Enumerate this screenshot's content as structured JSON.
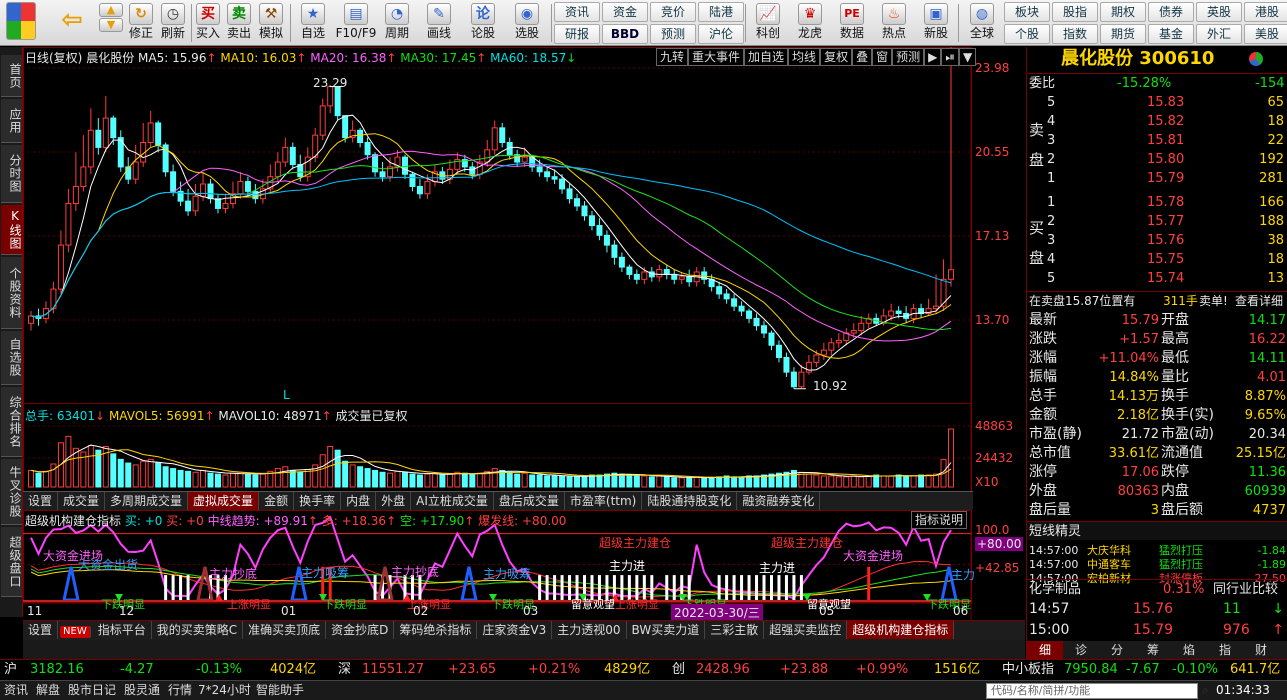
{
  "toolbar": {
    "buttons": [
      {
        "label": "买入"
      },
      {
        "label": "卖出"
      },
      {
        "label": "模拟"
      },
      {
        "label": "自选"
      },
      {
        "label": "F10/F9"
      },
      {
        "label": "周期"
      },
      {
        "label": "画线"
      },
      {
        "label": "论股"
      },
      {
        "label": "选股"
      },
      {
        "label": "修正"
      },
      {
        "label": "刷新"
      },
      {
        "label": "科创"
      },
      {
        "label": "龙虎"
      },
      {
        "label": "数据"
      },
      {
        "label": "热点"
      },
      {
        "label": "新股"
      },
      {
        "label": "全球"
      }
    ],
    "icon_glyphs": {
      "buy": "买",
      "sell": "卖",
      "lungu": "论",
      "data": "PE"
    },
    "grid1": [
      "资讯",
      "资金",
      "竞价",
      "陆港",
      "研报",
      "BBD",
      "预测",
      "沪伦"
    ],
    "grid2": [
      "板块",
      "股指",
      "期权",
      "债券",
      "英股",
      "港股",
      "个股",
      "指数",
      "期货",
      "基金",
      "外汇",
      "美股"
    ]
  },
  "left_tabs": [
    "首页",
    "应用",
    "分时图",
    "K线图",
    "个股资料",
    "自选股",
    "综合排名",
    "牛叉诊股",
    "超级盘口"
  ],
  "chart": {
    "header": {
      "period": "日线(复权)",
      "name": "晨化股份",
      "ma5": "MA5: 15.96",
      "ma10": "MA10: 16.03",
      "ma20": "MA20: 16.38",
      "ma30": "MA30: 17.45",
      "ma60": "MA60: 18.57",
      "up_arrow": "↑",
      "down_arrow": "↓"
    },
    "kbuttons": [
      "九转",
      "重大事件",
      "加自选",
      "均线",
      "复权",
      "叠",
      "窗",
      "预测",
      "▶",
      "⏯",
      "▼"
    ],
    "price_axis": [
      "23.98",
      "20.55",
      "17.13",
      "13.70"
    ],
    "high_label": "23.29",
    "low_label": "10.92",
    "l_marker": "L",
    "volume_header": {
      "total": "总手: 63401",
      "mavol5": "MAVOL5: 56991",
      "mavol10": "MAVOL10: 48971",
      "note": "成交量已复权"
    },
    "volume_axis": [
      "48863",
      "24432",
      "X10"
    ],
    "vol_tabs": [
      "设置",
      "成交量",
      "多周期成交量",
      "虚拟成交量",
      "金额",
      "换手率",
      "内盘",
      "外盘",
      "AI立桩成交量",
      "盘后成交量",
      "市盈率(ttm)",
      "陆股通持股变化",
      "融资融券变化"
    ],
    "vol_tab_active": 3,
    "ind_header": {
      "name": "超级机构建仓指标",
      "buy": "买: +0",
      "buy2": "买: +0",
      "trend": "中线趋势: +89.91",
      "duo": "多: +18.36",
      "kong": "空: +17.90",
      "bao": "爆发线: +80.00",
      "help": "指标说明"
    },
    "ind_axis": [
      "100.0",
      "+80.00",
      "+42.85"
    ],
    "ind_labels": [
      {
        "t": "大资金进场"
      },
      {
        "t": "大资金出货"
      },
      {
        "t": "主力抄底"
      },
      {
        "t": "主力吸筹"
      },
      {
        "t": "主力抄底"
      },
      {
        "t": "主力吸筹"
      },
      {
        "t": "超级主力建仓"
      },
      {
        "t": "主力进"
      },
      {
        "t": "超级主力建仓"
      },
      {
        "t": "主力进"
      },
      {
        "t": "大资金进场"
      },
      {
        "t": "主力"
      }
    ],
    "ind_bottom_labels": [
      {
        "t": "下跌明显"
      },
      {
        "t": "上涨明显"
      },
      {
        "t": "下跌明显"
      },
      {
        "t": "上涨明显"
      },
      {
        "t": "下跌明显"
      },
      {
        "t": "留意观望"
      },
      {
        "t": "上涨明显"
      },
      {
        "t": "下跌明显"
      },
      {
        "t": "留意观望"
      },
      {
        "t": "下跌明显"
      }
    ],
    "date_axis": [
      "11",
      "12",
      "01",
      "02",
      "03",
      "05",
      "06"
    ],
    "date_highlight": "2022-03-30/三",
    "bottom_tabs": [
      "设置",
      "NEW",
      "指标平台",
      "我的买卖策略C",
      "准确买卖顶底",
      "资金抄底D",
      "筹码绝杀指标",
      "庄家资金V3",
      "主力透视00",
      "BW买卖力道",
      "三彩主散",
      "超强买卖监控",
      "超级机构建仓指标"
    ],
    "bottom_tab_active": 12
  },
  "candles": {
    "o": [
      13.6,
      13.9,
      13.8,
      14.2,
      15.0,
      16.8,
      18.5,
      19.2,
      20.0,
      21.5,
      20.8,
      22.0,
      21.2,
      20.0,
      19.5,
      20.2,
      21.0,
      21.8,
      20.9,
      19.8,
      19.0,
      18.6,
      18.2,
      18.8,
      19.3,
      18.7,
      18.3,
      18.5,
      18.9,
      19.4,
      19.0,
      18.7,
      19.1,
      19.6,
      20.2,
      20.8,
      20.1,
      19.6,
      20.4,
      21.3,
      22.5,
      23.29,
      22.1,
      21.2,
      21.5,
      21.0,
      20.5,
      19.8,
      19.6,
      20.0,
      20.4,
      19.7,
      19.2,
      18.9,
      19.4,
      19.8,
      19.5,
      19.9,
      20.3,
      20.0,
      19.7,
      20.2,
      20.7,
      21.6,
      21.0,
      20.5,
      20.2,
      20.4,
      20.0,
      19.8,
      19.6,
      19.5,
      19.1,
      18.7,
      18.4,
      18.0,
      17.6,
      17.2,
      16.8,
      16.3,
      15.9,
      15.6,
      15.4,
      15.7,
      15.5,
      15.8,
      15.6,
      15.4,
      15.5,
      15.3,
      15.7,
      15.4,
      15.1,
      14.8,
      14.6,
      14.3,
      14.1,
      13.8,
      13.5,
      13.2,
      12.7,
      12.2,
      11.6,
      11.0,
      11.6,
      12.0,
      12.3,
      12.5,
      12.8,
      12.9,
      13.2,
      13.3,
      13.6,
      13.8,
      13.6,
      13.9,
      14.1,
      14.0,
      13.8,
      14.2,
      14.0,
      14.2,
      14.3,
      15.4
    ],
    "c": [
      13.9,
      13.8,
      14.2,
      15.0,
      16.8,
      18.5,
      19.2,
      20.0,
      21.5,
      20.8,
      22.0,
      21.2,
      20.0,
      19.5,
      20.2,
      21.0,
      21.8,
      20.9,
      19.8,
      19.0,
      18.6,
      18.2,
      18.8,
      19.3,
      18.7,
      18.3,
      18.5,
      18.9,
      19.4,
      19.0,
      18.7,
      19.1,
      19.6,
      20.2,
      20.8,
      20.1,
      19.6,
      20.4,
      21.3,
      22.5,
      23.29,
      22.1,
      21.2,
      21.5,
      21.0,
      20.5,
      19.8,
      19.6,
      20.0,
      20.4,
      19.7,
      19.2,
      18.9,
      19.4,
      19.8,
      19.5,
      19.9,
      20.3,
      20.0,
      19.7,
      20.2,
      20.7,
      21.6,
      21.0,
      20.5,
      20.2,
      20.4,
      20.0,
      19.8,
      19.6,
      19.5,
      19.1,
      18.7,
      18.4,
      18.0,
      17.6,
      17.2,
      16.8,
      16.3,
      15.9,
      15.6,
      15.4,
      15.7,
      15.5,
      15.8,
      15.6,
      15.4,
      15.5,
      15.3,
      15.7,
      15.4,
      15.1,
      14.8,
      14.6,
      14.3,
      14.1,
      13.8,
      13.5,
      13.2,
      12.7,
      12.2,
      11.6,
      11.0,
      11.6,
      12.0,
      12.3,
      12.5,
      12.8,
      12.9,
      13.2,
      13.3,
      13.6,
      13.8,
      13.6,
      13.9,
      14.1,
      14.0,
      13.8,
      14.2,
      14.0,
      14.2,
      14.3,
      15.4,
      15.79
    ],
    "h": [
      14.1,
      14.2,
      14.5,
      15.3,
      17.4,
      19.1,
      20.6,
      21.3,
      22.4,
      22.0,
      22.9,
      22.1,
      21.5,
      20.4,
      20.9,
      21.8,
      22.3,
      21.9,
      21.0,
      20.1,
      19.4,
      19.1,
      19.3,
      19.8,
      19.5,
      18.9,
      18.9,
      19.4,
      19.8,
      19.6,
      19.3,
      19.5,
      20.1,
      20.6,
      21.2,
      21.0,
      20.5,
      20.8,
      21.6,
      22.8,
      23.29,
      23.0,
      22.1,
      21.9,
      21.6,
      21.2,
      20.6,
      20.2,
      20.4,
      20.7,
      20.5,
      19.8,
      19.5,
      19.7,
      20.1,
      20.0,
      20.3,
      20.6,
      20.5,
      20.2,
      20.5,
      21.1,
      21.9,
      21.8,
      21.2,
      20.7,
      20.8,
      20.5,
      20.3,
      20.0,
      19.9,
      19.7,
      19.3,
      18.9,
      18.6,
      18.2,
      17.9,
      17.4,
      17.0,
      16.5,
      16.0,
      15.8,
      15.9,
      15.9,
      16.0,
      16.0,
      15.8,
      15.7,
      15.8,
      15.9,
      15.9,
      15.6,
      15.3,
      15.0,
      14.8,
      14.5,
      14.2,
      14.0,
      13.7,
      13.3,
      12.9,
      12.4,
      11.8,
      11.9,
      12.3,
      12.5,
      12.8,
      13.0,
      13.2,
      13.4,
      13.6,
      13.9,
      14.0,
      14.0,
      14.2,
      14.4,
      14.3,
      14.3,
      14.4,
      14.4,
      14.6,
      15.6,
      16.22
    ],
    "l": [
      13.3,
      13.5,
      13.6,
      14.0,
      14.8,
      16.5,
      18.2,
      19.0,
      19.7,
      20.5,
      20.6,
      20.9,
      19.8,
      19.3,
      19.3,
      20.0,
      20.8,
      20.6,
      19.6,
      18.8,
      18.4,
      18.0,
      18.0,
      18.6,
      18.5,
      18.1,
      18.1,
      18.3,
      18.7,
      18.8,
      18.5,
      18.5,
      18.9,
      19.4,
      20.0,
      19.9,
      19.4,
      19.4,
      20.2,
      21.1,
      22.2,
      21.9,
      21.0,
      21.0,
      20.8,
      20.3,
      19.6,
      19.4,
      19.4,
      19.8,
      19.5,
      19.0,
      18.7,
      18.7,
      19.2,
      19.3,
      19.3,
      19.7,
      19.8,
      19.5,
      19.5,
      20.0,
      20.5,
      20.8,
      20.3,
      20.0,
      20.0,
      19.8,
      19.6,
      19.4,
      19.3,
      18.9,
      18.5,
      18.2,
      17.8,
      17.4,
      17.0,
      16.5,
      16.0,
      15.7,
      15.4,
      15.2,
      15.2,
      15.3,
      15.3,
      15.4,
      15.2,
      15.2,
      15.1,
      15.1,
      15.2,
      14.9,
      14.6,
      14.4,
      14.1,
      13.9,
      13.6,
      13.3,
      13.0,
      12.5,
      12.0,
      11.4,
      10.92,
      10.95,
      11.5,
      11.8,
      12.1,
      12.3,
      12.6,
      12.7,
      13.0,
      13.1,
      13.4,
      13.5,
      13.5,
      13.7,
      13.8,
      13.6,
      13.6,
      13.8,
      13.9,
      14.0,
      14.1,
      15.1
    ],
    "v": [
      18,
      15,
      17,
      25,
      48,
      55,
      42,
      38,
      45,
      40,
      44,
      36,
      30,
      26,
      24,
      28,
      30,
      26,
      22,
      20,
      18,
      17,
      16,
      18,
      15,
      14,
      13,
      15,
      16,
      14,
      13,
      14,
      17,
      20,
      22,
      18,
      16,
      19,
      24,
      35,
      44,
      40,
      28,
      24,
      22,
      20,
      18,
      16,
      15,
      17,
      16,
      14,
      13,
      14,
      15,
      13,
      14,
      16,
      15,
      14,
      15,
      17,
      20,
      18,
      16,
      14,
      15,
      13,
      13,
      12,
      12,
      12,
      11,
      11,
      12,
      13,
      13,
      14,
      15,
      14,
      13,
      12,
      12,
      11,
      12,
      11,
      10,
      10,
      10,
      11,
      10,
      10,
      11,
      12,
      11,
      11,
      12,
      12,
      13,
      14,
      15,
      16,
      18,
      16,
      14,
      13,
      12,
      12,
      11,
      11,
      12,
      11,
      12,
      13,
      12,
      12,
      13,
      12,
      12,
      13,
      13,
      14,
      30,
      63
    ]
  },
  "right": {
    "title": "晨化股份 300610",
    "weibi_label": "委比",
    "weibi_val": "-15.28%",
    "weibi_val2": "-154",
    "sell_label": [
      "卖",
      "盘"
    ],
    "buy_label": [
      "买",
      "盘"
    ],
    "sells": [
      {
        "n": "5",
        "p": "15.83",
        "v": "65"
      },
      {
        "n": "4",
        "p": "15.82",
        "v": "18"
      },
      {
        "n": "3",
        "p": "15.81",
        "v": "22"
      },
      {
        "n": "2",
        "p": "15.80",
        "v": "192"
      },
      {
        "n": "1",
        "p": "15.79",
        "v": "281"
      }
    ],
    "buys": [
      {
        "n": "1",
        "p": "15.78",
        "v": "166"
      },
      {
        "n": "2",
        "p": "15.77",
        "v": "188"
      },
      {
        "n": "3",
        "p": "15.76",
        "v": "38"
      },
      {
        "n": "4",
        "p": "15.75",
        "v": "18"
      },
      {
        "n": "5",
        "p": "15.74",
        "v": "13"
      }
    ],
    "note": "在卖盘15.87位置有",
    "note_vol": "311手",
    "note_sell": "卖单!",
    "note_link": "查看详细",
    "stats": [
      {
        "k1": "最新",
        "v1": "15.79",
        "c1": "red",
        "k2": "开盘",
        "v2": "14.17",
        "c2": "green"
      },
      {
        "k1": "涨跌",
        "v1": "+1.57",
        "c1": "red",
        "k2": "最高",
        "v2": "16.22",
        "c2": "red"
      },
      {
        "k1": "涨幅",
        "v1": "+11.04%",
        "c1": "red",
        "k2": "最低",
        "v2": "14.11",
        "c2": "green"
      },
      {
        "k1": "振幅",
        "v1": "14.84%",
        "c1": "yellow",
        "k2": "量比",
        "v2": "4.01",
        "c2": "red"
      },
      {
        "k1": "总手",
        "v1": "14.13万",
        "c1": "yellow",
        "k2": "换手",
        "v2": "8.87%",
        "c2": "yellow"
      },
      {
        "k1": "金额",
        "v1": "2.18亿",
        "c1": "yellow",
        "k2": "换手(实)",
        "v2": "9.65%",
        "c2": "yellow"
      },
      {
        "k1": "市盈(静)",
        "v1": "21.72",
        "c1": "white",
        "k2": "市盈(动)",
        "v2": "20.34",
        "c2": "white"
      },
      {
        "k1": "总市值",
        "v1": "33.61亿",
        "c1": "yellow",
        "k2": "流通值",
        "v2": "25.15亿",
        "c2": "yellow"
      },
      {
        "k1": "涨停",
        "v1": "17.06",
        "c1": "red",
        "k2": "跌停",
        "v2": "11.36",
        "c2": "green"
      },
      {
        "k1": "外盘",
        "v1": "80363",
        "c1": "red",
        "k2": "内盘",
        "v2": "60939",
        "c2": "green"
      },
      {
        "k1": "盘后量",
        "v1": "3",
        "c1": "yellow",
        "k2": "盘后额",
        "v2": "4737",
        "c2": "yellow"
      }
    ],
    "spirit_title": "短线精灵",
    "spirit": [
      {
        "t": "14:57:00",
        "n": "大庆华科",
        "a": "猛烈打压",
        "v": "-1.84"
      },
      {
        "t": "14:57:00",
        "n": "中通客车",
        "a": "猛烈打压",
        "v": "-1.89"
      },
      {
        "t": "14:57:00",
        "n": "宏柏新材",
        "a": "封涨停板",
        "v": "27.50"
      }
    ],
    "industry": "化学制品",
    "industry_pct": "0.31%",
    "industry_btn": "同行业比较",
    "ticks": [
      {
        "t": "14:57",
        "p": "15.76",
        "v": "11",
        "d": "down"
      },
      {
        "t": "15:00",
        "p": "15.79",
        "v": "976",
        "d": "up"
      }
    ],
    "bottom_tabs": [
      "细",
      "诊",
      "分",
      "筹",
      "焰",
      "指",
      "财"
    ]
  },
  "status": {
    "sh_label": "沪",
    "sh": "3182.16",
    "sh_chg": "-4.27",
    "sh_pct": "-0.13%",
    "sh_amt": "4024亿",
    "sz_label": "深",
    "sz": "11551.27",
    "sz_chg": "+23.65",
    "sz_pct": "+0.21%",
    "sz_amt": "4829亿",
    "cy_label": "创",
    "cy": "2428.96",
    "cy_chg": "+23.88",
    "cy_pct": "+0.99%",
    "cy_amt": "1516亿",
    "zx_label": "中小板指",
    "zx": "7950.84",
    "zx_chg": "-7.67",
    "zx_pct": "-0.10%",
    "zx_amt": "641.7亿"
  },
  "bottombar": {
    "items": [
      "资讯",
      "解盘",
      "股市日记",
      "股灵通",
      "行情",
      "7*24小时",
      "智能助手"
    ],
    "search_placeholder": "代码/名称/简拼/功能",
    "time": "01:34:33"
  }
}
